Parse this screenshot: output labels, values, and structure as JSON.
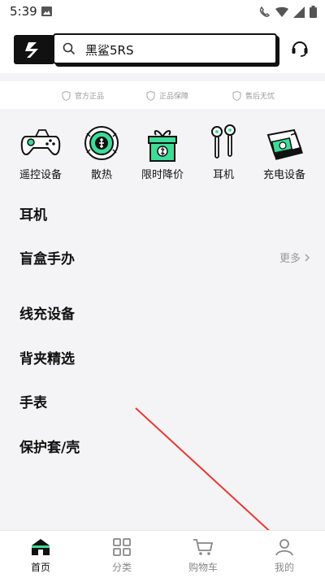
{
  "status_bar": {
    "time": "5:39"
  },
  "header": {
    "search_text": "黑鲨5RS"
  },
  "guarantees": [
    {
      "label": "官方正品",
      "icon": "shield-icon"
    },
    {
      "label": "正品保障",
      "icon": "shield-icon"
    },
    {
      "label": "售后无忧",
      "icon": "shield-icon"
    }
  ],
  "categories": [
    {
      "label": "遥控设备",
      "icon": "gamepad-icon"
    },
    {
      "label": "散热",
      "icon": "cooler-icon"
    },
    {
      "label": "限时降价",
      "icon": "gift-icon"
    },
    {
      "label": "耳机",
      "icon": "earphones-icon"
    },
    {
      "label": "充电设备",
      "icon": "charger-icon"
    }
  ],
  "list": [
    {
      "title": "耳机"
    },
    {
      "title": "盲盒手办",
      "more": "更多"
    },
    {
      "title": "线充设备"
    },
    {
      "title": "背夹精选"
    },
    {
      "title": "手表"
    },
    {
      "title": "保护套/壳"
    }
  ],
  "tabs": [
    {
      "label": "首页",
      "icon": "home-icon",
      "active": true
    },
    {
      "label": "分类",
      "icon": "grid-icon"
    },
    {
      "label": "购物车",
      "icon": "cart-icon"
    },
    {
      "label": "我的",
      "icon": "profile-icon"
    }
  ],
  "colors": {
    "accent": "#3ddc97",
    "annotation": "#e53935",
    "dark": "#111111"
  }
}
